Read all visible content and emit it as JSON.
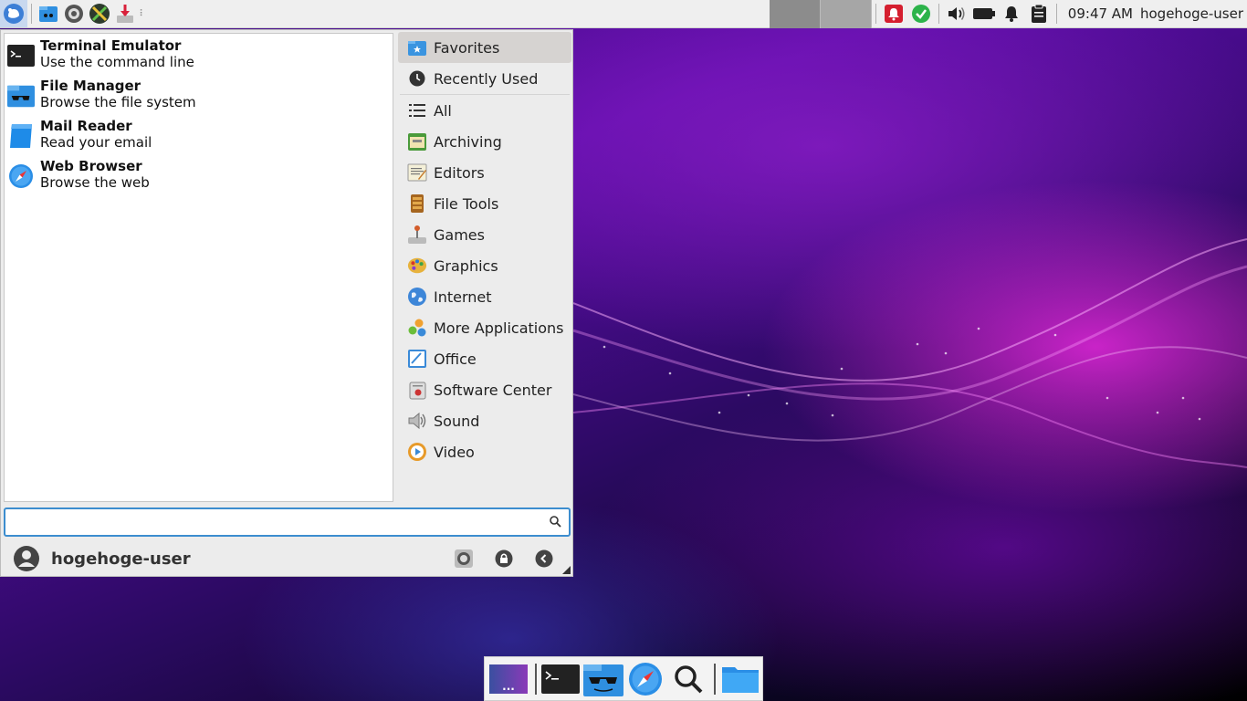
{
  "top_panel": {
    "launchers": [
      {
        "icon": "whisker-menu-icon"
      },
      {
        "icon": "file-manager-icon"
      },
      {
        "icon": "settings-icon"
      },
      {
        "icon": "tools-icon"
      },
      {
        "icon": "download-icon"
      }
    ],
    "tray_icons": [
      "notification-alert-icon",
      "check-icon",
      "volume-icon",
      "battery-icon",
      "bell-icon",
      "clipboard-icon"
    ],
    "clock": "09:47 AM",
    "user": "hogehoge-user"
  },
  "menu": {
    "favorites": [
      {
        "name": "Terminal Emulator",
        "desc": "Use the command line",
        "icon": "terminal-icon"
      },
      {
        "name": "File Manager",
        "desc": "Browse the file system",
        "icon": "file-manager-icon"
      },
      {
        "name": "Mail Reader",
        "desc": "Read your email",
        "icon": "mail-icon"
      },
      {
        "name": "Web Browser",
        "desc": "Browse the web",
        "icon": "compass-icon"
      }
    ],
    "categories": [
      {
        "label": "Favorites",
        "icon": "star-folder-icon",
        "active": true
      },
      {
        "label": "Recently Used",
        "icon": "clock-icon"
      },
      {
        "label": "All",
        "icon": "list-icon"
      },
      {
        "label": "Archiving",
        "icon": "archive-icon"
      },
      {
        "label": "Editors",
        "icon": "editor-icon"
      },
      {
        "label": "File Tools",
        "icon": "file-tools-icon"
      },
      {
        "label": "Games",
        "icon": "joystick-icon"
      },
      {
        "label": "Graphics",
        "icon": "palette-icon"
      },
      {
        "label": "Internet",
        "icon": "globe-icon"
      },
      {
        "label": "More Applications",
        "icon": "more-apps-icon"
      },
      {
        "label": "Office",
        "icon": "office-icon"
      },
      {
        "label": "Software Center",
        "icon": "software-center-icon"
      },
      {
        "label": "Sound",
        "icon": "speaker-icon"
      },
      {
        "label": "Video",
        "icon": "video-icon"
      }
    ],
    "search": {
      "value": "",
      "placeholder": ""
    },
    "footer_user": "hogehoge-user"
  },
  "dock": {
    "items": [
      "show-desktop-icon",
      "terminal-icon",
      "file-manager-icon",
      "compass-icon",
      "search-icon",
      "folder-icon"
    ],
    "show_desktop_label": "..."
  }
}
